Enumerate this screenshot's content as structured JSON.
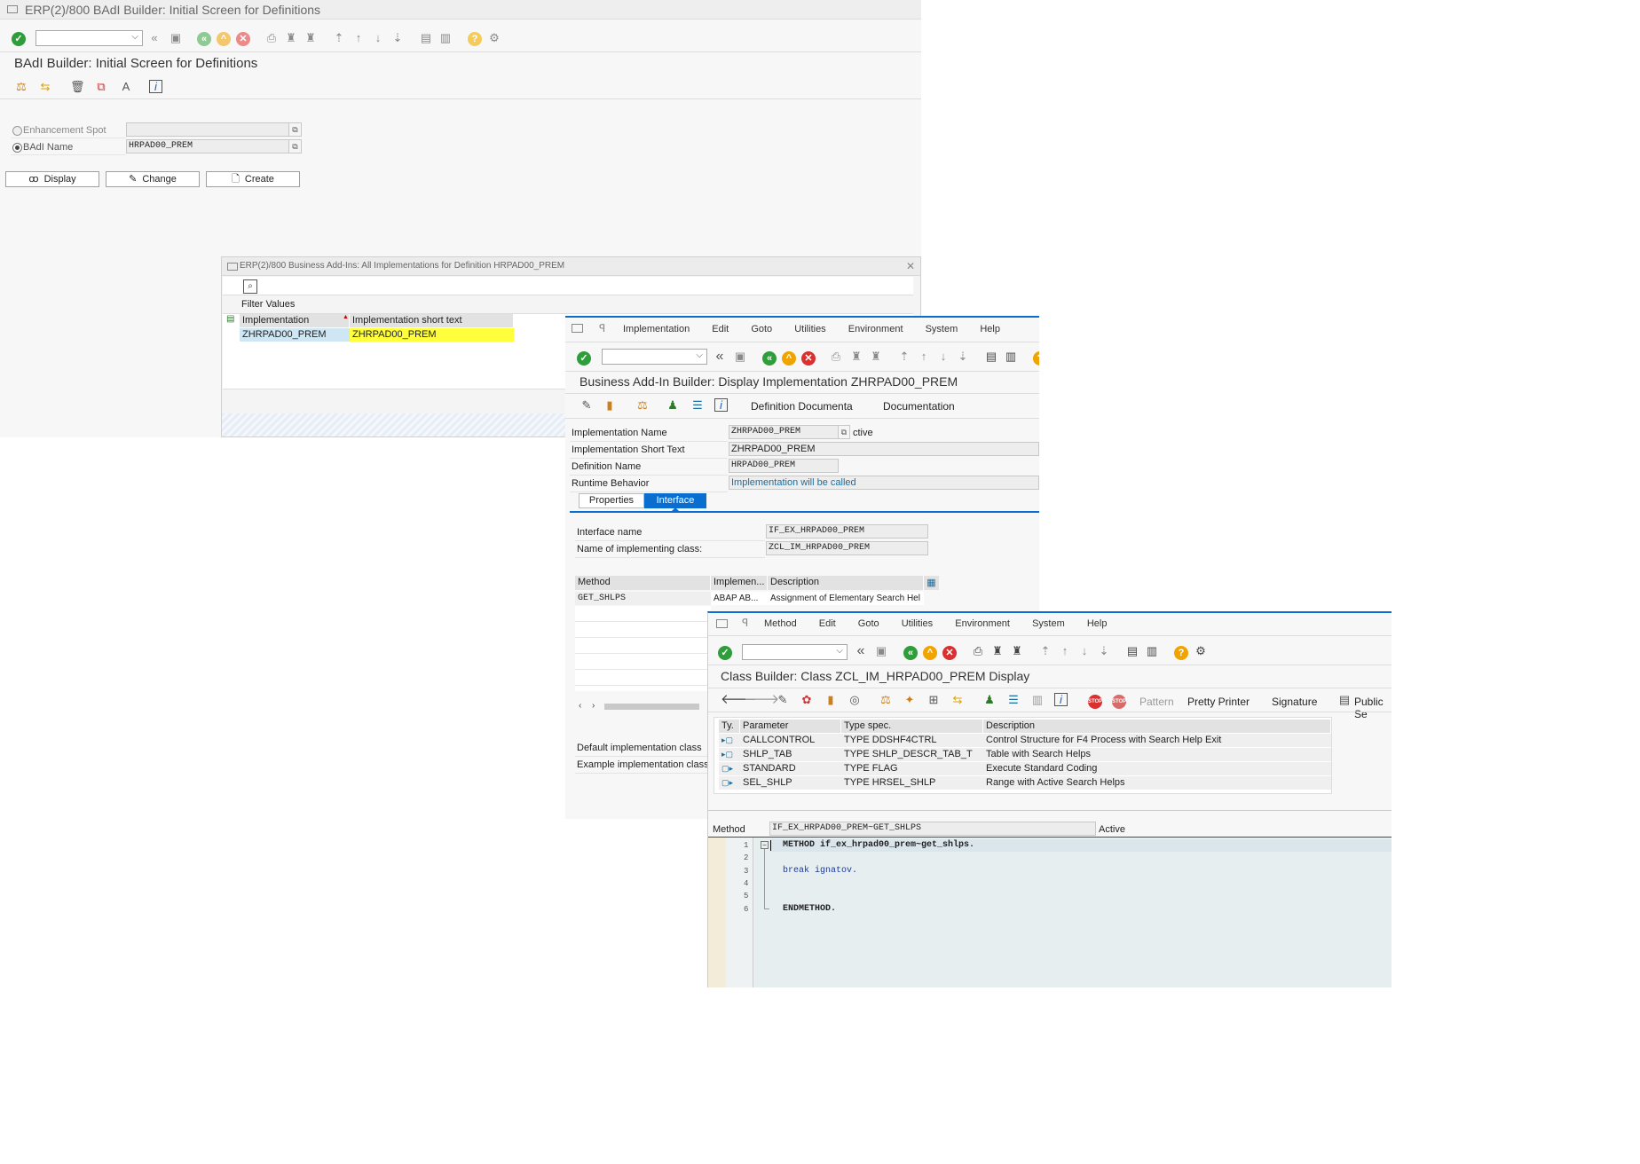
{
  "win1": {
    "title": "ERP(2)/800 BAdI Builder: Initial Screen for Definitions",
    "heading": "BAdI Builder: Initial Screen for Definitions",
    "enhancement_spot_label": "Enhancement Spot",
    "enhancement_spot_value": "",
    "badi_name_label": "BAdI Name",
    "badi_name_value": "HRPAD00_PREM",
    "btn_display": "Display",
    "btn_change": "Change",
    "btn_create": "Create",
    "selected_radio": "badi_name"
  },
  "win2": {
    "title": "ERP(2)/800 Business Add-Ins: All Implementations for Definition HRPAD00_PREM",
    "filter_label": "Filter Values",
    "columns": [
      "Implementation",
      "Implementation short text"
    ],
    "rows": [
      [
        "ZHRPAD00_PREM",
        "ZHRPAD00_PREM"
      ]
    ],
    "highlight_color": "#ffff3c",
    "selected_color": "#cfe6f5"
  },
  "win3": {
    "menu": [
      "Implementation",
      "Edit",
      "Goto",
      "Utilities",
      "Environment",
      "System",
      "Help"
    ],
    "heading": "Business Add-In Builder: Display Implementation ZHRPAD00_PREM",
    "toolbar_text_buttons": [
      "Definition Documenta",
      "Documentation"
    ],
    "fields": [
      {
        "label": "Implementation Name",
        "value": "ZHRPAD00_PREM",
        "suffix": "ctive"
      },
      {
        "label": "Implementation Short Text",
        "value": "ZHRPAD00_PREM"
      },
      {
        "label": "Definition Name",
        "value": "HRPAD00_PREM"
      },
      {
        "label": "Runtime Behavior",
        "value": "Implementation will be called"
      }
    ],
    "tabs": [
      "Properties",
      "Interface"
    ],
    "active_tab": "Interface",
    "interface_name_label": "Interface name",
    "interface_name_value": "IF_EX_HRPAD00_PREM",
    "impl_class_label": "Name of implementing class:",
    "impl_class_value": "ZCL_IM_HRPAD00_PREM",
    "method_columns": [
      "Method",
      "Implemen...",
      "Description"
    ],
    "method_rows": [
      [
        "GET_SHLPS",
        "ABAP AB...",
        "Assignment of Elementary Search Hel"
      ]
    ],
    "default_impl_label": "Default implementation class",
    "example_impl_label": "Example implementation class",
    "accent": "#0a6ed1"
  },
  "win4": {
    "menu": [
      "Method",
      "Edit",
      "Goto",
      "Utilities",
      "Environment",
      "System",
      "Help"
    ],
    "heading": "Class Builder: Class ZCL_IM_HRPAD00_PREM Display",
    "toolbar_text_buttons": [
      "Pattern",
      "Pretty Printer",
      "Signature",
      "Public Se"
    ],
    "param_columns": [
      "Ty.",
      "Parameter",
      "Type spec.",
      "Description"
    ],
    "param_rows": [
      {
        "type_icon": "importing-icon",
        "parameter": "CALLCONTROL",
        "type_spec": "TYPE DDSHF4CTRL",
        "description": "Control Structure for F4 Process with Search Help Exit"
      },
      {
        "type_icon": "importing-icon",
        "parameter": "SHLP_TAB",
        "type_spec": "TYPE SHLP_DESCR_TAB_T",
        "description": "Table with Search Helps"
      },
      {
        "type_icon": "changing-icon",
        "parameter": "STANDARD",
        "type_spec": "TYPE FLAG",
        "description": "Execute Standard Coding"
      },
      {
        "type_icon": "changing-icon",
        "parameter": "SEL_SHLP",
        "type_spec": "TYPE HRSEL_SHLP",
        "description": "Range with Active Search Helps"
      }
    ],
    "method_label": "Method",
    "method_value": "IF_EX_HRPAD00_PREM~GET_SHLPS",
    "method_status": "Active",
    "code_lines": [
      {
        "no": "1",
        "text": "METHOD if_ex_hrpad00_prem~get_shlps."
      },
      {
        "no": "2",
        "text": ""
      },
      {
        "no": "3",
        "text": "break ignatov."
      },
      {
        "no": "4",
        "text": ""
      },
      {
        "no": "5",
        "text": ""
      },
      {
        "no": "6",
        "text": "ENDMETHOD."
      }
    ],
    "accent": "#0a6ed1"
  }
}
